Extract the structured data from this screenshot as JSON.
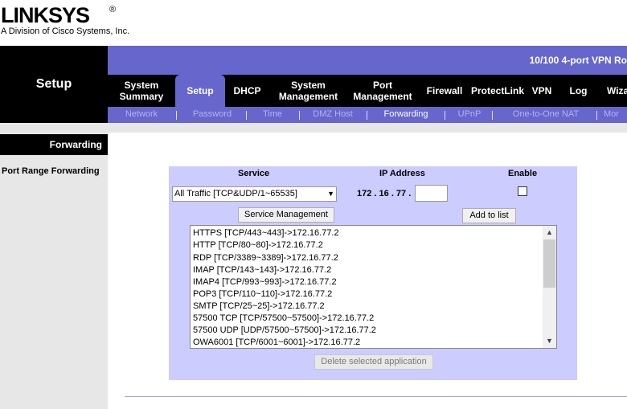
{
  "logo": {
    "brand": "LINKSYS",
    "reg": "®",
    "subtitle": "A Division of Cisco Systems, Inc."
  },
  "section_title": "Setup",
  "product_title": "10/100 4-port VPN Ro",
  "tabs": [
    {
      "label": "System\nSummary",
      "active": false
    },
    {
      "label": "Setup",
      "active": true
    },
    {
      "label": "DHCP",
      "active": false
    },
    {
      "label": "System\nManagement",
      "active": false
    },
    {
      "label": "Port\nManagement",
      "active": false
    },
    {
      "label": "Firewall",
      "active": false
    },
    {
      "label": "ProtectLink",
      "active": false
    },
    {
      "label": "VPN",
      "active": false
    },
    {
      "label": "Log",
      "active": false
    },
    {
      "label": "Wiza",
      "active": false
    }
  ],
  "subtabs": [
    {
      "label": "Network",
      "active": false
    },
    {
      "label": "Password",
      "active": false
    },
    {
      "label": "Time",
      "active": false
    },
    {
      "label": "DMZ Host",
      "active": false
    },
    {
      "label": "Forwarding",
      "active": true
    },
    {
      "label": "UPnP",
      "active": false
    },
    {
      "label": "One-to-One NAT",
      "active": false
    },
    {
      "label": "Mor",
      "active": false
    }
  ],
  "sidebar": {
    "header": "Forwarding",
    "section": "Port Range Forwarding"
  },
  "form": {
    "headers": {
      "service": "Service",
      "ip": "IP Address",
      "enable": "Enable"
    },
    "service_selected": "All Traffic [TCP&UDP/1~65535]",
    "ip_prefix": "172 . 16 . 77 .",
    "ip_last_octet": "",
    "enable_checked": false,
    "service_mgmt_button": "Service Management",
    "add_button": "Add to list",
    "delete_button": "Delete selected application"
  },
  "app_list": [
    "HTTPS [TCP/443~443]->172.16.77.2",
    "HTTP [TCP/80~80]->172.16.77.2",
    "RDP [TCP/3389~3389]->172.16.77.2",
    "IMAP [TCP/143~143]->172.16.77.2",
    "IMAP4 [TCP/993~993]->172.16.77.2",
    "POP3 [TCP/110~110]->172.16.77.2",
    "SMTP [TCP/25~25]->172.16.77.2",
    "57500 TCP [TCP/57500~57500]->172.16.77.2",
    "57500 UDP [UDP/57500~57500]->172.16.77.2",
    "OWA6001 [TCP/6001~6001]->172.16.77.2"
  ],
  "colors": {
    "accent": "#6666cc",
    "panel": "#ccccff",
    "band": "#000000"
  }
}
